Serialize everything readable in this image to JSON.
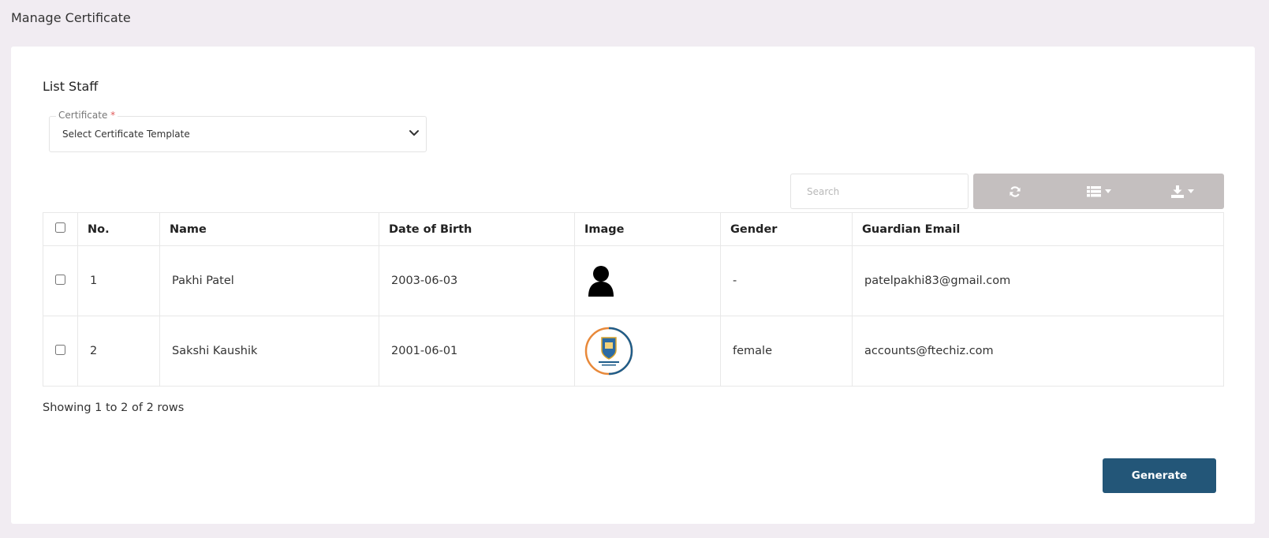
{
  "page": {
    "title": "Manage Certificate"
  },
  "section": {
    "title": "List Staff"
  },
  "certificate_select": {
    "label": "Certificate",
    "required_mark": "*",
    "value": "Select Certificate Template"
  },
  "search": {
    "placeholder": "Search"
  },
  "toolbar": {
    "refresh_icon": "refresh-icon",
    "columns_icon": "columns-list-icon",
    "export_icon": "download-icon"
  },
  "table": {
    "columns": [
      "No.",
      "Name",
      "Date of Birth",
      "Image",
      "Gender",
      "Guardian Email"
    ],
    "rows": [
      {
        "no": "1",
        "name": "Pakhi Patel",
        "dob": "2003-06-03",
        "image": "person-placeholder-icon",
        "gender": "-",
        "email": "patelpakhi83@gmail.com"
      },
      {
        "no": "2",
        "name": "Sakshi Kaushik",
        "dob": "2001-06-01",
        "image": "school-logo",
        "gender": "female",
        "email": "accounts@ftechiz.com"
      }
    ]
  },
  "pagination": {
    "summary": "Showing 1 to 2 of 2 rows"
  },
  "actions": {
    "generate_label": "Generate"
  },
  "colors": {
    "page_bg": "#f1ecf2",
    "toolbar_bg": "#c4bfbf",
    "primary_button": "#235678",
    "required": "#e05a5a"
  }
}
